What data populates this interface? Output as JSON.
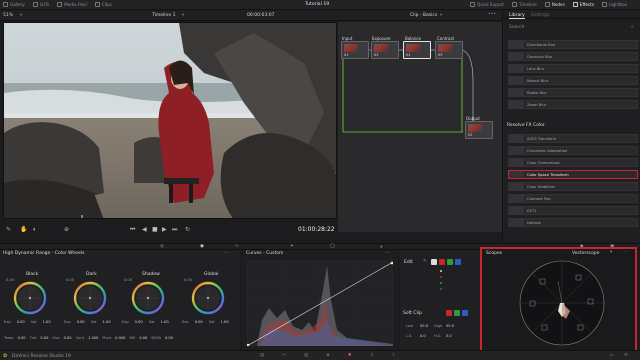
{
  "topbar": {
    "tabs": [
      "Gallery",
      "LUTs",
      "Media Pool",
      "Clips"
    ],
    "title": "Tutorial 19",
    "right": [
      "Quick Export",
      "Timeline",
      "Nodes",
      "Effects",
      "Lightbox"
    ]
  },
  "viewer_bar": {
    "zoom": "51%",
    "timeline": "Timeline 1",
    "timecode": "00:00:03:07",
    "clip_name": "Clip - Basics"
  },
  "transport": {
    "timecode": "01:00:28:22"
  },
  "nodes": {
    "items": [
      {
        "label": "Input",
        "num": "01"
      },
      {
        "label": "Exposure",
        "num": "03"
      },
      {
        "label": "Balance",
        "num": "04"
      },
      {
        "label": "Contrast",
        "num": "05"
      },
      {
        "label": "Output",
        "num": "02"
      }
    ]
  },
  "library": {
    "tab_active": "Library",
    "tab_other": "Settings",
    "search": "Search",
    "items": [
      "Directional Blur",
      "Gaussian Blur",
      "Lens Blur",
      "Mosaic Blur",
      "Radial Blur",
      "Zoom Blur"
    ],
    "section": "Resolve FX Color",
    "color_items": [
      "ACES Transform",
      "Chromatic Adaptation",
      "Color Compressor",
      "Color Space Transform",
      "Color Stabilizer",
      "Contrast Pop",
      "DCTL",
      "Dehaze"
    ]
  },
  "wheels": {
    "title": "High Dynamic Range - Color Wheels",
    "items": [
      {
        "name": "Black",
        "val": "0.00"
      },
      {
        "name": "Dark",
        "val": "0.00"
      },
      {
        "name": "Shadow",
        "val": "0.00"
      },
      {
        "name": "Global",
        "val": "0.00"
      }
    ],
    "row1": [
      "Exp",
      "0.00",
      "Sat",
      "1.00"
    ],
    "row2": [
      "Temp",
      "0.00",
      "Tint",
      "0.00",
      "Hue",
      "0.00",
      "Cont",
      "1.000",
      "Pivot",
      "0.000",
      "MD",
      "0.00",
      "B/Ofs",
      "0.00"
    ]
  },
  "curves": {
    "title": "Curves - Custom"
  },
  "edit": {
    "title": "Edit",
    "soft_clip": "Soft Clip",
    "low_label": "Low",
    "low_val": "50.0",
    "high_label": "High",
    "high_val": "50.0",
    "ls_label": "L.S.",
    "ls_val": "0.0",
    "hs_label": "H.S.",
    "hs_val": "0.0"
  },
  "scopes": {
    "title": "Scopes",
    "mode": "Vectorscope"
  },
  "status": {
    "app": "DaVinci Resolve Studio 19"
  },
  "colors": {
    "accent": "#c8262c",
    "node_line": "#7fd12a"
  }
}
